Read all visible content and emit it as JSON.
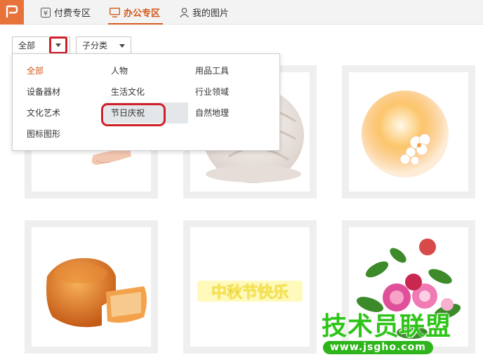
{
  "tabs": [
    {
      "label": "付费专区",
      "icon": "yen-icon"
    },
    {
      "label": "办公专区",
      "icon": "monitor-icon",
      "active": true
    },
    {
      "label": "我的图片",
      "icon": "user-icon"
    }
  ],
  "filters": {
    "category_value": "全部",
    "subcategory_value": "子分类"
  },
  "dropdown": {
    "items": [
      "全部",
      "人物",
      "用品工具",
      "设备器材",
      "生活文化",
      "行业领域",
      "文化艺术",
      "节日庆祝",
      "自然地理",
      "图标图形"
    ],
    "selected": "全部",
    "hovered": "节日庆祝"
  },
  "gallery": {
    "banner_text": "中秋节快乐"
  },
  "watermark": {
    "title": "技术员联盟",
    "url": "www.jsgho.com"
  },
  "colors": {
    "accent": "#d25a1c",
    "logo": "#e8733a",
    "annotation": "#d0202a",
    "watermark": "#2fc41a"
  }
}
